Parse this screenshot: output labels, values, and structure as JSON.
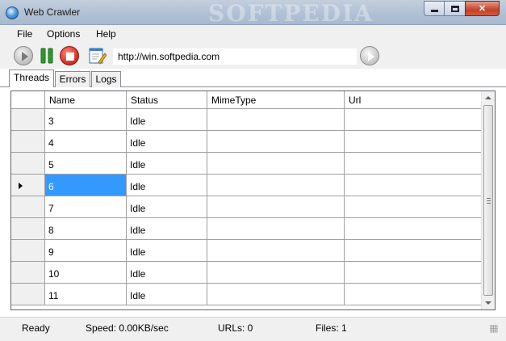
{
  "window": {
    "title": "Web Crawler",
    "watermark": "SOFTPEDIA",
    "controls": {
      "minimize": "minimize-icon",
      "maximize": "maximize-icon",
      "close": "close-icon"
    }
  },
  "menu": [
    "File",
    "Options",
    "Help"
  ],
  "toolbar": {
    "buttons": [
      "play-icon",
      "pause-icon",
      "stop-icon",
      "notepad-icon"
    ],
    "url": "http://win.softpedia.com",
    "go": "go-arrow-icon"
  },
  "tabs": [
    "Threads",
    "Errors",
    "Logs"
  ],
  "active_tab": "Threads",
  "grid": {
    "columns": [
      "Name",
      "Status",
      "MimeType",
      "Url"
    ],
    "rows": [
      {
        "name": "3",
        "status": "Idle",
        "mimetype": "",
        "url": ""
      },
      {
        "name": "4",
        "status": "Idle",
        "mimetype": "",
        "url": ""
      },
      {
        "name": "5",
        "status": "Idle",
        "mimetype": "",
        "url": ""
      },
      {
        "name": "6",
        "status": "Idle",
        "mimetype": "",
        "url": ""
      },
      {
        "name": "7",
        "status": "Idle",
        "mimetype": "",
        "url": ""
      },
      {
        "name": "8",
        "status": "Idle",
        "mimetype": "",
        "url": ""
      },
      {
        "name": "9",
        "status": "Idle",
        "mimetype": "",
        "url": ""
      },
      {
        "name": "10",
        "status": "Idle",
        "mimetype": "",
        "url": ""
      },
      {
        "name": "11",
        "status": "Idle",
        "mimetype": "",
        "url": ""
      }
    ],
    "selected_row": "6"
  },
  "status": {
    "state": "Ready",
    "speed": "Speed: 0.00KB/sec",
    "urls": "URLs: 0",
    "files": "Files: 1"
  },
  "colors": {
    "selection": "#3399ff",
    "stop": "#d9382a",
    "pause": "#2e9a2e"
  }
}
